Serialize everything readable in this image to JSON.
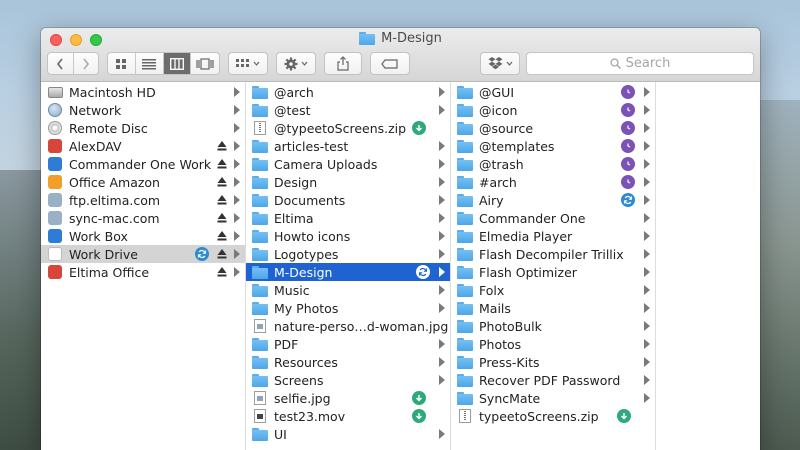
{
  "window": {
    "title": "M-Design"
  },
  "toolbar": {
    "search_placeholder": "Search"
  },
  "col1": [
    {
      "label": "Macintosh HD",
      "icon": "drive",
      "chev": true
    },
    {
      "label": "Network",
      "icon": "globe",
      "chev": true
    },
    {
      "label": "Remote Disc",
      "icon": "disc",
      "chev": true
    },
    {
      "label": "AlexDAV",
      "icon": "app-red",
      "eject": true,
      "chev": true
    },
    {
      "label": "Commander One Work",
      "icon": "app-blue",
      "eject": true,
      "chev": true
    },
    {
      "label": "Office Amazon",
      "icon": "app-orange",
      "eject": true,
      "chev": true
    },
    {
      "label": "ftp.eltima.com",
      "icon": "app-gray",
      "eject": true,
      "chev": true
    },
    {
      "label": "sync-mac.com",
      "icon": "app-gray",
      "eject": true,
      "chev": true
    },
    {
      "label": "Work Box",
      "icon": "app-blue",
      "eject": true,
      "chev": true
    },
    {
      "label": "Work Drive",
      "icon": "app-white",
      "eject": true,
      "chev": true,
      "status": "blue",
      "highlight": true
    },
    {
      "label": "Eltima Office",
      "icon": "app-red",
      "eject": true,
      "chev": true
    }
  ],
  "col2": [
    {
      "label": "@arch",
      "icon": "folder",
      "chev": true
    },
    {
      "label": "@test",
      "icon": "folder",
      "chev": true
    },
    {
      "label": "@typeetoScreens.zip",
      "icon": "zip",
      "status": "green"
    },
    {
      "label": "articles-test",
      "icon": "folder",
      "chev": true
    },
    {
      "label": "Camera Uploads",
      "icon": "folder",
      "chev": true
    },
    {
      "label": "Design",
      "icon": "folder",
      "chev": true
    },
    {
      "label": "Documents",
      "icon": "folder",
      "chev": true
    },
    {
      "label": "Eltima",
      "icon": "folder",
      "chev": true
    },
    {
      "label": "Howto icons",
      "icon": "folder",
      "chev": true
    },
    {
      "label": "Logotypes",
      "icon": "folder",
      "chev": true
    },
    {
      "label": "M-Design",
      "icon": "folder",
      "chev": true,
      "status": "white",
      "selected": true
    },
    {
      "label": "Music",
      "icon": "folder",
      "chev": true
    },
    {
      "label": "My Photos",
      "icon": "folder",
      "chev": true
    },
    {
      "label": "nature-perso…d-woman.jpg",
      "icon": "doc"
    },
    {
      "label": "PDF",
      "icon": "folder",
      "chev": true
    },
    {
      "label": "Resources",
      "icon": "folder",
      "chev": true
    },
    {
      "label": "Screens",
      "icon": "folder",
      "chev": true
    },
    {
      "label": "selfie.jpg",
      "icon": "doc",
      "status": "green"
    },
    {
      "label": "test23.mov",
      "icon": "mov",
      "status": "green"
    },
    {
      "label": "UI",
      "icon": "folder",
      "chev": true
    }
  ],
  "col3": [
    {
      "label": "@GUI",
      "icon": "folder",
      "chev": true,
      "status": "purple"
    },
    {
      "label": "@icon",
      "icon": "folder",
      "chev": true,
      "status": "purple"
    },
    {
      "label": "@source",
      "icon": "folder",
      "chev": true,
      "status": "purple"
    },
    {
      "label": "@templates",
      "icon": "folder",
      "chev": true,
      "status": "purple"
    },
    {
      "label": "@trash",
      "icon": "folder",
      "chev": true,
      "status": "purple"
    },
    {
      "label": "#arch",
      "icon": "folder",
      "chev": true,
      "status": "purple"
    },
    {
      "label": "Airy",
      "icon": "folder",
      "chev": true,
      "status": "blue"
    },
    {
      "label": "Commander One",
      "icon": "folder",
      "chev": true
    },
    {
      "label": "Elmedia Player",
      "icon": "folder",
      "chev": true
    },
    {
      "label": "Flash Decompiler Trillix",
      "icon": "folder",
      "chev": true
    },
    {
      "label": "Flash Optimizer",
      "icon": "folder",
      "chev": true
    },
    {
      "label": "Folx",
      "icon": "folder",
      "chev": true
    },
    {
      "label": "Mails",
      "icon": "folder",
      "chev": true
    },
    {
      "label": "PhotoBulk",
      "icon": "folder",
      "chev": true
    },
    {
      "label": "Photos",
      "icon": "folder",
      "chev": true
    },
    {
      "label": "Press-Kits",
      "icon": "folder",
      "chev": true
    },
    {
      "label": "Recover PDF Password",
      "icon": "folder",
      "chev": true
    },
    {
      "label": "SyncMate",
      "icon": "folder",
      "chev": true
    },
    {
      "label": "typeetoScreens.zip",
      "icon": "zip",
      "status": "green"
    }
  ],
  "colors": {
    "selection": "#1f63d3",
    "folder": "#5aaee8",
    "sync_green": "#2eaa7a",
    "sync_purple": "#7a52b8",
    "sync_blue": "#2e8ad8"
  }
}
